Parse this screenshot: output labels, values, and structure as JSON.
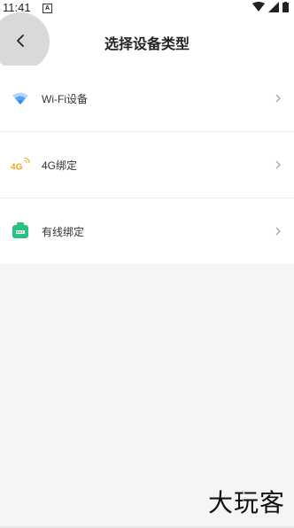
{
  "status_bar": {
    "time": "11:41",
    "notification_icon": "A"
  },
  "header": {
    "title": "选择设备类型"
  },
  "device_types": [
    {
      "label": "Wi-Fi设备",
      "icon": "wifi-icon"
    },
    {
      "label": "4G绑定",
      "icon": "4g-icon",
      "icon_text": "4G"
    },
    {
      "label": "有线绑定",
      "icon": "ethernet-icon"
    }
  ],
  "watermark": "大玩客",
  "colors": {
    "wifi": "#2f8cf4",
    "four_g": "#f5a623",
    "ethernet": "#26c281",
    "chevron": "#999999"
  }
}
